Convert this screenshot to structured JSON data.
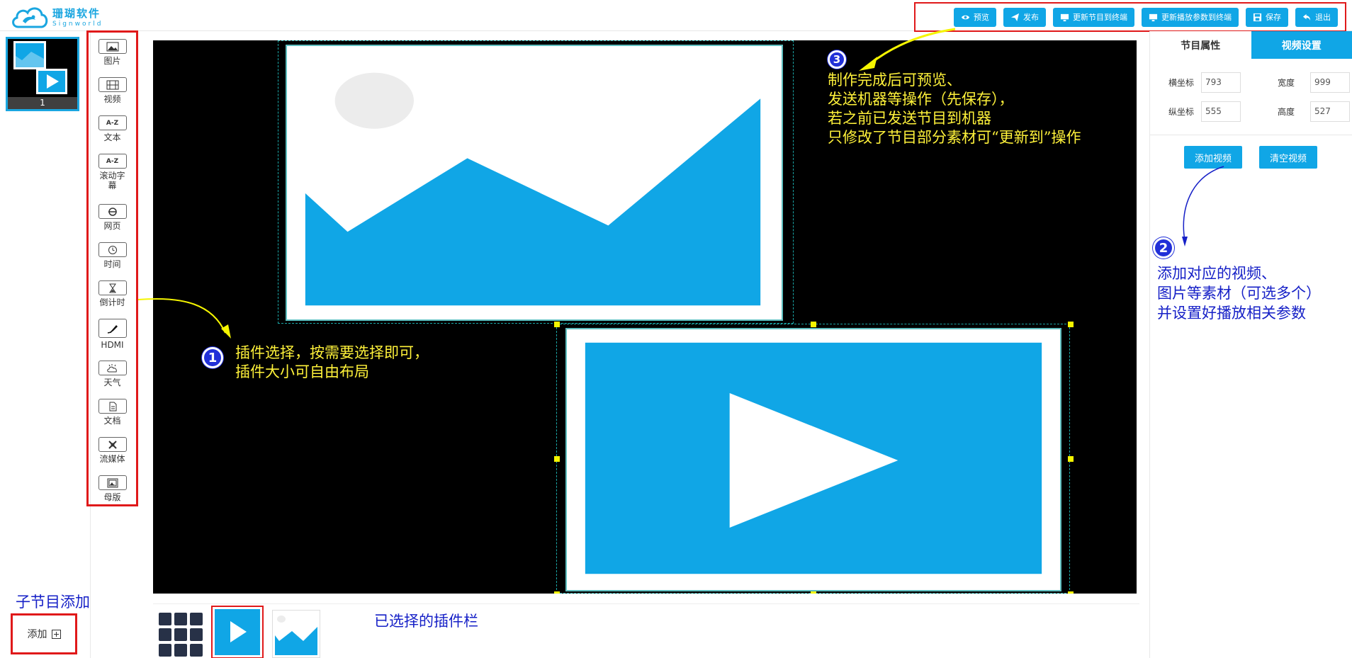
{
  "brand": {
    "name_cn": "珊瑚软件",
    "name_en": "Signworld"
  },
  "toolbar": {
    "buttons": [
      {
        "label": "预览",
        "icon": "eye-icon"
      },
      {
        "label": "发布",
        "icon": "send-icon"
      },
      {
        "label": "更新节目到终端",
        "icon": "monitor-icon"
      },
      {
        "label": "更新播放参数到终端",
        "icon": "monitor-icon"
      },
      {
        "label": "保存",
        "icon": "save-icon"
      },
      {
        "label": "退出",
        "icon": "exit-icon"
      }
    ]
  },
  "thumbnail": {
    "number": "1"
  },
  "plugins": [
    {
      "label": "图片",
      "icon": "image-icon"
    },
    {
      "label": "视频",
      "icon": "film-icon"
    },
    {
      "label": "文本",
      "icon": "text-icon",
      "glyph": "A-Z"
    },
    {
      "label": "滚动字幕",
      "icon": "marquee-icon",
      "glyph": "A-Z"
    },
    {
      "label": "网页",
      "icon": "browser-icon"
    },
    {
      "label": "时间",
      "icon": "clock-icon"
    },
    {
      "label": "倒计时",
      "icon": "hourglass-icon"
    },
    {
      "label": "HDMI",
      "icon": "hdmi-icon"
    },
    {
      "label": "天气",
      "icon": "weather-icon"
    },
    {
      "label": "文档",
      "icon": "document-icon"
    },
    {
      "label": "流媒体",
      "icon": "stream-icon"
    },
    {
      "label": "母版",
      "icon": "template-icon"
    }
  ],
  "annotations": {
    "step1": {
      "badge": "1",
      "lines": [
        "插件选择，按需要选择即可，",
        "插件大小可自由布局"
      ]
    },
    "step2": {
      "badge": "2",
      "lines": [
        "添加对应的视频、",
        "图片等素材（可选多个）",
        "并设置好播放相关参数"
      ]
    },
    "step3": {
      "badge": "3",
      "lines": [
        "制作完成后可预览、",
        "发送机器等操作（先保存），",
        "若之前已发送节目到机器",
        "只修改了节目部分素材可“更新到”操作"
      ]
    },
    "sub_program": "子节目添加",
    "selected_bar": "已选择的插件栏"
  },
  "right_panel": {
    "tabs": [
      {
        "label": "节目属性",
        "active": false
      },
      {
        "label": "视频设置",
        "active": true
      }
    ],
    "fields": {
      "x": {
        "label": "横坐标",
        "value": "793"
      },
      "width": {
        "label": "宽度",
        "value": "999"
      },
      "y": {
        "label": "纵坐标",
        "value": "555"
      },
      "height": {
        "label": "高度",
        "value": "527"
      }
    },
    "add_video": "添加视频",
    "clear_video": "清空视频"
  },
  "bottom": {
    "add_label": "添加"
  },
  "colors": {
    "accent": "#10a6e6",
    "highlight": "#e0191a",
    "annotation_yellow": "#fff23a",
    "annotation_blue": "#1620c7"
  }
}
